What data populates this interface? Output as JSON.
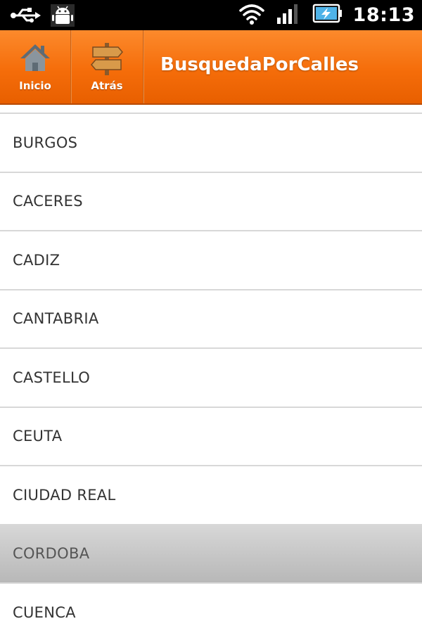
{
  "status_bar": {
    "time": "18:13",
    "left_icons": [
      "usb-icon",
      "android-debug-icon"
    ],
    "right_icons": [
      "wifi-icon",
      "signal-icon",
      "battery-charging-icon"
    ]
  },
  "action_bar": {
    "home_label": "Inicio",
    "back_label": "Atrás",
    "title": "BusquedaPorCalles",
    "color": "#f56d0a"
  },
  "list": {
    "items": [
      {
        "label": "BURGOS",
        "selected": false
      },
      {
        "label": "CACERES",
        "selected": false
      },
      {
        "label": "CADIZ",
        "selected": false
      },
      {
        "label": "CANTABRIA",
        "selected": false
      },
      {
        "label": "CASTELLO",
        "selected": false
      },
      {
        "label": "CEUTA",
        "selected": false
      },
      {
        "label": "CIUDAD REAL",
        "selected": false
      },
      {
        "label": "CORDOBA",
        "selected": true
      },
      {
        "label": "CUENCA",
        "selected": false
      }
    ]
  }
}
